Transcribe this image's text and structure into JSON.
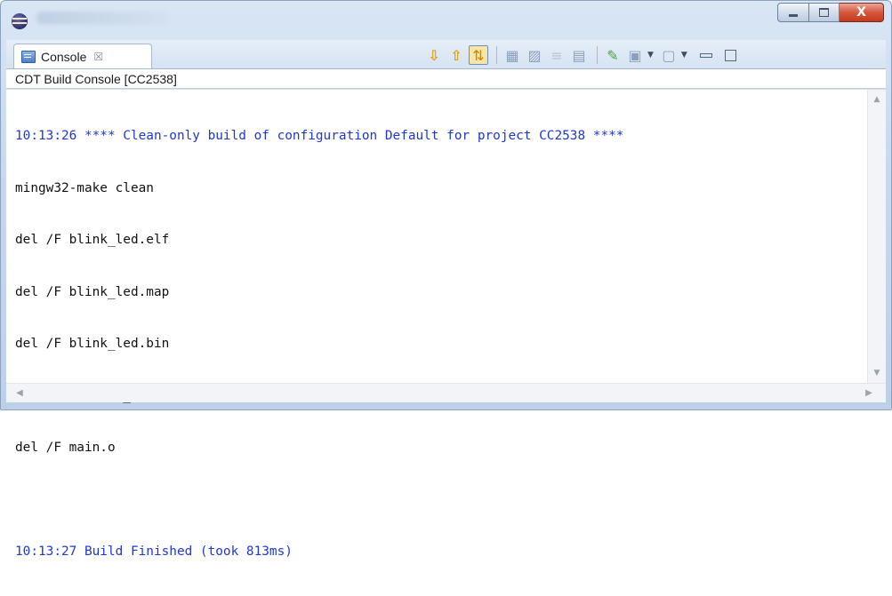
{
  "window": {
    "app_icon": "eclipse-icon",
    "controls": {
      "minimize": "minimize-icon",
      "maximize": "maximize-icon",
      "close_label": "X"
    }
  },
  "view": {
    "tab_label": "Console",
    "tab_close_glyph": "☒",
    "toolbar": [
      {
        "name": "scroll-down-icon",
        "glyph": "⇩"
      },
      {
        "name": "scroll-up-icon",
        "glyph": "⇧"
      },
      {
        "name": "scroll-lock-icon",
        "glyph": "⇅"
      },
      {
        "name": "word-wrap-icon",
        "glyph": "▦"
      },
      {
        "name": "show-console-icon",
        "glyph": "▨"
      },
      {
        "name": "clear-console-icon",
        "glyph": "≡"
      },
      {
        "name": "remove-console-icon",
        "glyph": "▤"
      },
      {
        "name": "pin-console-icon",
        "glyph": "✎"
      },
      {
        "name": "display-console-icon",
        "glyph": "▣"
      },
      {
        "name": "open-console-icon",
        "glyph": "▢"
      }
    ]
  },
  "console": {
    "header": "CDT Build Console [CC2538]",
    "lines": [
      {
        "text": "10:13:26 **** Clean-only build of configuration Default for project CC2538 ****",
        "kind": "info"
      },
      {
        "text": "mingw32-make clean",
        "kind": "output"
      },
      {
        "text": "del /F blink_led.elf",
        "kind": "output"
      },
      {
        "text": "del /F blink_led.map",
        "kind": "output"
      },
      {
        "text": "del /F blink_led.bin",
        "kind": "output"
      },
      {
        "text": "del /F startup_gcc.o",
        "kind": "output"
      },
      {
        "text": "del /F main.o",
        "kind": "output"
      },
      {
        "text": "",
        "kind": "blank"
      },
      {
        "text": "10:13:27 Build Finished (took 813ms)",
        "kind": "info"
      }
    ]
  },
  "colors": {
    "info_text": "#1f36d4",
    "output_text": "#111111"
  }
}
